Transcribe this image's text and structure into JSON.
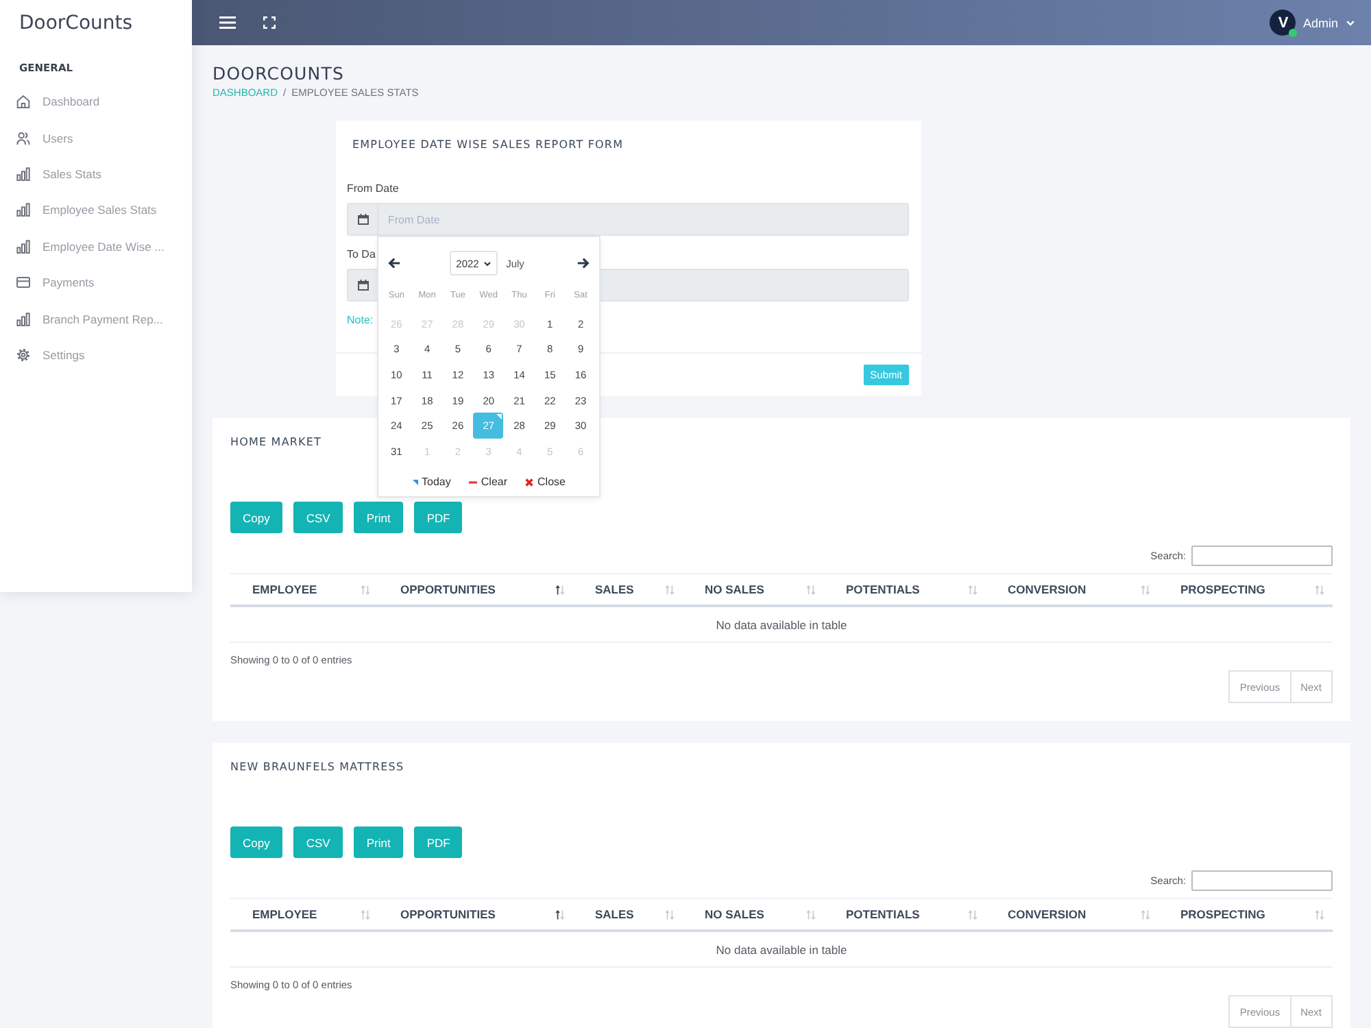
{
  "sidebar": {
    "logo": "DoorCounts",
    "section": "GENERAL",
    "items": [
      {
        "label": "Dashboard",
        "kind": "home"
      },
      {
        "label": "Users",
        "kind": "users"
      },
      {
        "label": "Sales Stats",
        "kind": "chart"
      },
      {
        "label": "Employee Sales Stats",
        "kind": "chart"
      },
      {
        "label": "Employee Date Wise ...",
        "kind": "chart"
      },
      {
        "label": "Payments",
        "kind": "card"
      },
      {
        "label": "Branch Payment Rep...",
        "kind": "chart"
      },
      {
        "label": "Settings",
        "kind": "gear"
      }
    ]
  },
  "topbar": {
    "user": {
      "initial": "V",
      "online": true,
      "name": "Admin"
    }
  },
  "page": {
    "title": "DOORCOUNTS",
    "breadcrumb": [
      {
        "label": "DASHBOARD",
        "link": true
      },
      {
        "label": "EMPLOYEE SALES STATS",
        "link": false
      }
    ],
    "breadcrumb_separator": "/"
  },
  "report_form": {
    "title": "EMPLOYEE DATE WISE SALES REPORT FORM",
    "fields": [
      {
        "label": "From Date",
        "placeholder": "From Date"
      },
      {
        "label": "To Da"
      }
    ],
    "note": "Note:",
    "submit": "Submit"
  },
  "datepicker": {
    "year": "2022",
    "month": "July",
    "weekdays": [
      "Sun",
      "Mon",
      "Tue",
      "Wed",
      "Thu",
      "Fri",
      "Sat"
    ],
    "weeks": [
      [
        {
          "day": "26",
          "muted": true,
          "selected": false,
          "today": false
        },
        {
          "day": "27",
          "muted": true,
          "selected": false,
          "today": false
        },
        {
          "day": "28",
          "muted": true,
          "selected": false,
          "today": false
        },
        {
          "day": "29",
          "muted": true,
          "selected": false,
          "today": false
        },
        {
          "day": "30",
          "muted": true,
          "selected": false,
          "today": false
        },
        {
          "day": "1",
          "muted": false,
          "selected": false,
          "today": false
        },
        {
          "day": "2",
          "muted": false,
          "selected": false,
          "today": false
        }
      ],
      [
        {
          "day": "3",
          "muted": false,
          "selected": false,
          "today": false
        },
        {
          "day": "4",
          "muted": false,
          "selected": false,
          "today": false
        },
        {
          "day": "5",
          "muted": false,
          "selected": false,
          "today": false
        },
        {
          "day": "6",
          "muted": false,
          "selected": false,
          "today": false
        },
        {
          "day": "7",
          "muted": false,
          "selected": false,
          "today": false
        },
        {
          "day": "8",
          "muted": false,
          "selected": false,
          "today": false
        },
        {
          "day": "9",
          "muted": false,
          "selected": false,
          "today": false
        }
      ],
      [
        {
          "day": "10",
          "muted": false,
          "selected": false,
          "today": false
        },
        {
          "day": "11",
          "muted": false,
          "selected": false,
          "today": false
        },
        {
          "day": "12",
          "muted": false,
          "selected": false,
          "today": false
        },
        {
          "day": "13",
          "muted": false,
          "selected": false,
          "today": false
        },
        {
          "day": "14",
          "muted": false,
          "selected": false,
          "today": false
        },
        {
          "day": "15",
          "muted": false,
          "selected": false,
          "today": false
        },
        {
          "day": "16",
          "muted": false,
          "selected": false,
          "today": false
        }
      ],
      [
        {
          "day": "17",
          "muted": false,
          "selected": false,
          "today": false
        },
        {
          "day": "18",
          "muted": false,
          "selected": false,
          "today": false
        },
        {
          "day": "19",
          "muted": false,
          "selected": false,
          "today": false
        },
        {
          "day": "20",
          "muted": false,
          "selected": false,
          "today": false
        },
        {
          "day": "21",
          "muted": false,
          "selected": false,
          "today": false
        },
        {
          "day": "22",
          "muted": false,
          "selected": false,
          "today": false
        },
        {
          "day": "23",
          "muted": false,
          "selected": false,
          "today": false
        }
      ],
      [
        {
          "day": "24",
          "muted": false,
          "selected": false,
          "today": false
        },
        {
          "day": "25",
          "muted": false,
          "selected": false,
          "today": false
        },
        {
          "day": "26",
          "muted": false,
          "selected": false,
          "today": false
        },
        {
          "day": "27",
          "muted": false,
          "selected": true,
          "today": true
        },
        {
          "day": "28",
          "muted": false,
          "selected": false,
          "today": false
        },
        {
          "day": "29",
          "muted": false,
          "selected": false,
          "today": false
        },
        {
          "day": "30",
          "muted": false,
          "selected": false,
          "today": false
        }
      ],
      [
        {
          "day": "31",
          "muted": false,
          "selected": false,
          "today": false
        },
        {
          "day": "1",
          "muted": true,
          "selected": false,
          "today": false
        },
        {
          "day": "2",
          "muted": true,
          "selected": false,
          "today": false
        },
        {
          "day": "3",
          "muted": true,
          "selected": false,
          "today": false
        },
        {
          "day": "4",
          "muted": true,
          "selected": false,
          "today": false
        },
        {
          "day": "5",
          "muted": true,
          "selected": false,
          "today": false
        },
        {
          "day": "6",
          "muted": true,
          "selected": false,
          "today": false
        }
      ]
    ],
    "actions": [
      {
        "label": "Today",
        "kind": "today"
      },
      {
        "label": "Clear",
        "kind": "clear"
      },
      {
        "label": "Close",
        "kind": "close"
      }
    ]
  },
  "tables": [
    {
      "title": "HOME MARKET",
      "buttons": [
        "Copy",
        "CSV",
        "Print",
        "PDF"
      ],
      "search_label": "Search:",
      "columns": [
        {
          "label": "EMPLOYEE",
          "sorted": false
        },
        {
          "label": "OPPORTUNITIES",
          "sorted": true
        },
        {
          "label": "SALES",
          "sorted": false
        },
        {
          "label": "NO SALES",
          "sorted": false
        },
        {
          "label": "POTENTIALS",
          "sorted": false
        },
        {
          "label": "CONVERSION",
          "sorted": false
        },
        {
          "label": "PROSPECTING",
          "sorted": false
        }
      ],
      "empty_message": "No data available in table",
      "info": "Showing 0 to 0 of 0 entries",
      "pagination": [
        {
          "label": "Previous",
          "disabled": true
        },
        {
          "label": "Next",
          "disabled": true
        }
      ]
    },
    {
      "title": "NEW BRAUNFELS MATTRESS",
      "buttons": [
        "Copy",
        "CSV",
        "Print",
        "PDF"
      ],
      "search_label": "Search:",
      "columns": [
        {
          "label": "EMPLOYEE",
          "sorted": false
        },
        {
          "label": "OPPORTUNITIES",
          "sorted": true
        },
        {
          "label": "SALES",
          "sorted": false
        },
        {
          "label": "NO SALES",
          "sorted": false
        },
        {
          "label": "POTENTIALS",
          "sorted": false
        },
        {
          "label": "CONVERSION",
          "sorted": false
        },
        {
          "label": "PROSPECTING",
          "sorted": false
        }
      ],
      "empty_message": "No data available in table",
      "info": "Showing 0 to 0 of 0 entries",
      "pagination": [
        {
          "label": "Previous",
          "disabled": true
        },
        {
          "label": "Next",
          "disabled": true
        }
      ]
    }
  ]
}
